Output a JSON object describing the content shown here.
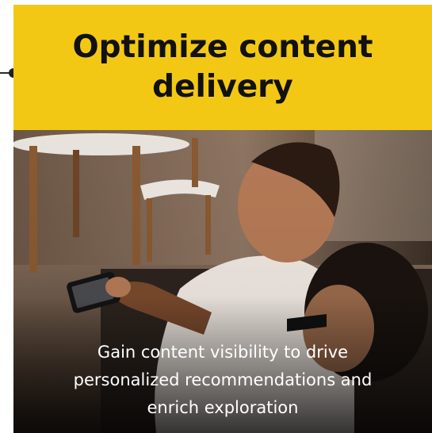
{
  "card": {
    "title": "Optimize content delivery",
    "description": "Gain content visibility to drive personalized recommendations and enrich exploration",
    "image_alt": "photo-people-watching-phone"
  },
  "colors": {
    "header_bg": "#f2c815",
    "title_text": "#111111",
    "caption_text": "#ffffff"
  }
}
